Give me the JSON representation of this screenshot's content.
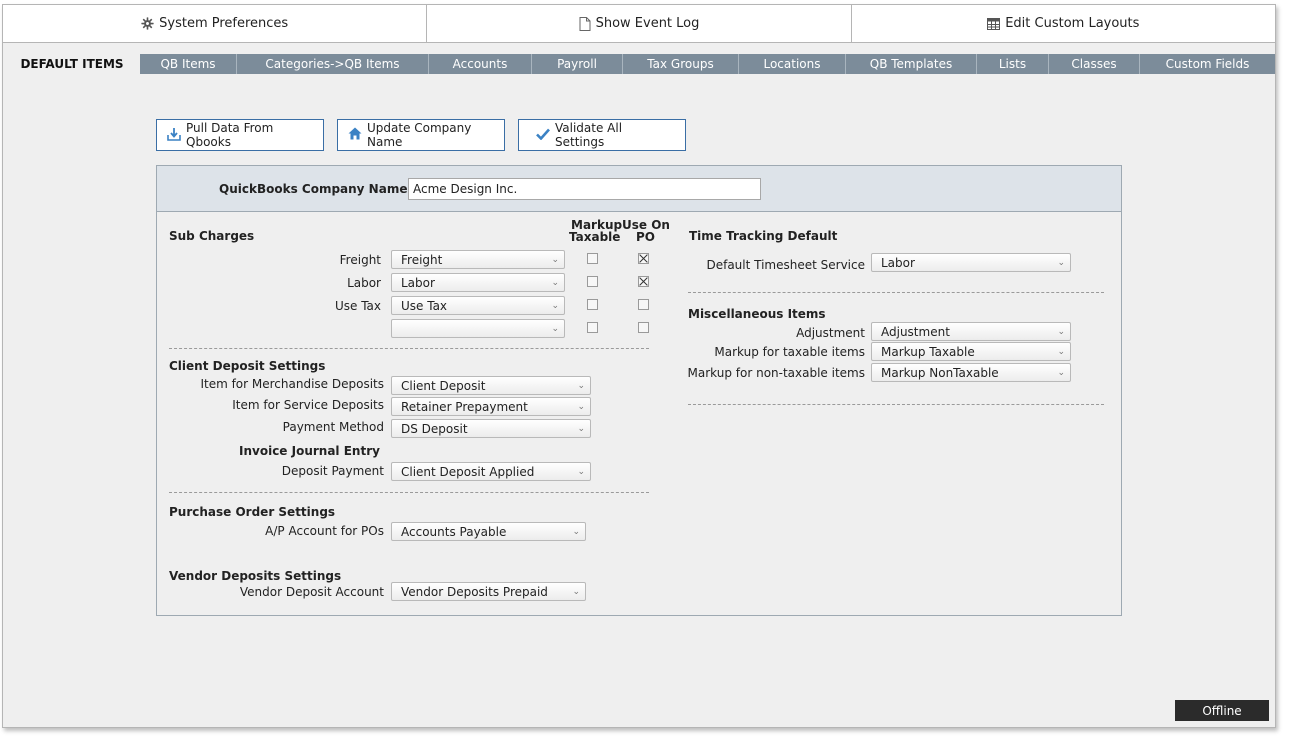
{
  "topbar": {
    "system_preferences": "System Preferences",
    "show_event_log": "Show Event Log",
    "edit_custom_layouts": "Edit Custom Layouts"
  },
  "tabs": [
    {
      "label": "DEFAULT ITEMS",
      "active": true
    },
    {
      "label": "QB Items"
    },
    {
      "label": "Categories->QB Items"
    },
    {
      "label": "Accounts"
    },
    {
      "label": "Payroll"
    },
    {
      "label": "Tax Groups"
    },
    {
      "label": "Locations"
    },
    {
      "label": "QB Templates"
    },
    {
      "label": "Lists"
    },
    {
      "label": "Classes"
    },
    {
      "label": "Custom Fields"
    }
  ],
  "actions": {
    "pull_data": "Pull Data From Qbooks",
    "update_company": "Update Company Name",
    "validate": "Validate All Settings"
  },
  "company": {
    "label": "QuickBooks Company Name",
    "value": "Acme Design Inc."
  },
  "sub_charges": {
    "title": "Sub Charges",
    "col_markup_1": "Markup",
    "col_markup_2": "Taxable",
    "col_po_1": "Use On",
    "col_po_2": "PO",
    "rows": [
      {
        "label": "Freight",
        "value": "Freight",
        "markup_taxable": false,
        "use_on_po": true
      },
      {
        "label": "Labor",
        "value": "Labor",
        "markup_taxable": false,
        "use_on_po": true
      },
      {
        "label": "Use Tax",
        "value": "Use Tax",
        "markup_taxable": false,
        "use_on_po": false
      },
      {
        "label": "",
        "value": "",
        "markup_taxable": false,
        "use_on_po": false
      }
    ]
  },
  "client_deposit": {
    "title": "Client Deposit Settings",
    "merch_label": "Item for Merchandise Deposits",
    "merch_value": "Client Deposit",
    "service_label": "Item for Service Deposits",
    "service_value": "Retainer Prepayment",
    "payment_label": "Payment Method",
    "payment_value": "DS Deposit",
    "journal_title": "Invoice Journal Entry",
    "deposit_payment_label": "Deposit Payment",
    "deposit_payment_value": "Client Deposit Applied"
  },
  "purchase_order": {
    "title": "Purchase Order Settings",
    "ap_label": "A/P Account for POs",
    "ap_value": "Accounts Payable"
  },
  "vendor_deposits": {
    "title": "Vendor Deposits Settings",
    "account_label": "Vendor Deposit Account",
    "account_value": "Vendor Deposits Prepaid"
  },
  "time_tracking": {
    "title": "Time Tracking Default",
    "service_label": "Default Timesheet Service",
    "service_value": "Labor"
  },
  "misc": {
    "title": "Miscellaneous Items",
    "adjustment_label": "Adjustment",
    "adjustment_value": "Adjustment",
    "markup_taxable_label": "Markup for taxable items",
    "markup_taxable_value": "Markup Taxable",
    "markup_nontaxable_label": "Markup for non-taxable items",
    "markup_nontaxable_value": "Markup NonTaxable"
  },
  "status": "Offline",
  "colors": {
    "tab_bar": "#7c8c9a",
    "button_border": "#3a6ea5",
    "icon_blue": "#3b82c4",
    "status_bg": "#2b2b2b"
  }
}
